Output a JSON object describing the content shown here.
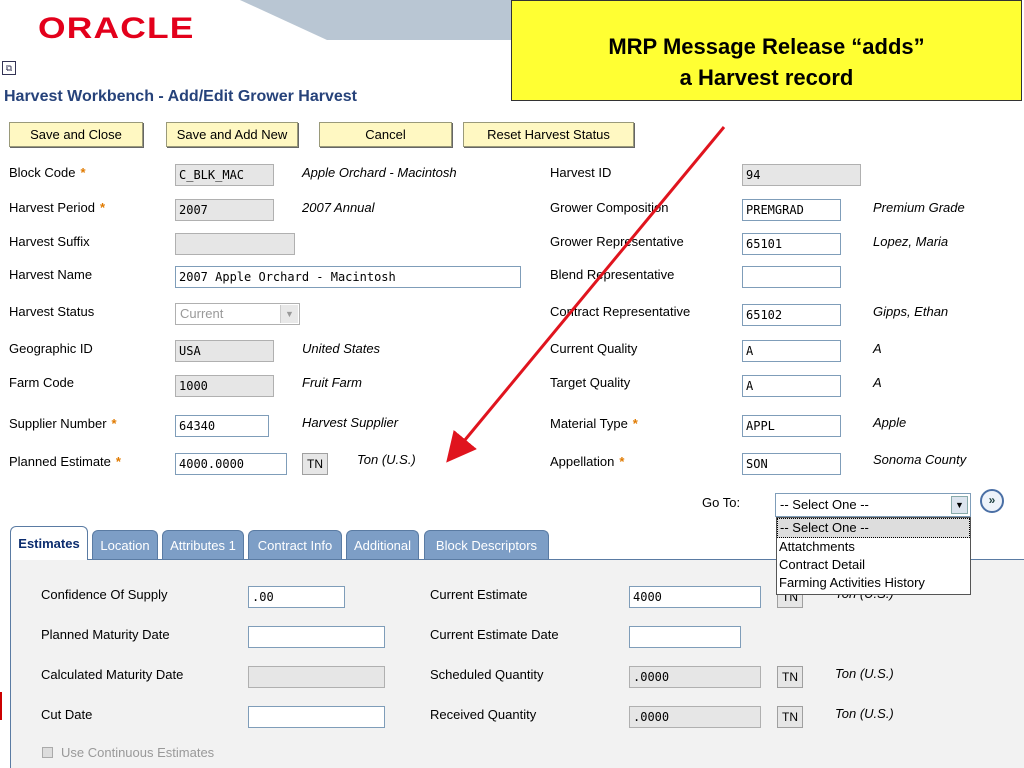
{
  "brand": {
    "logo_text": "ORACLE",
    "logo_color": "#e3001b"
  },
  "callout": {
    "line1": "MRP Message Release “adds”",
    "line2": "a Harvest record"
  },
  "page_title": "Harvest Workbench - Add/Edit Grower Harvest",
  "toolbar": {
    "save_close": "Save and Close",
    "save_add_new": "Save and Add New",
    "cancel": "Cancel",
    "reset_status": "Reset Harvest Status"
  },
  "left_fields": {
    "block_code": {
      "label": "Block Code",
      "value": "C_BLK_MAC",
      "desc": "Apple Orchard - Macintosh"
    },
    "harvest_period": {
      "label": "Harvest Period",
      "value": "2007",
      "desc": "2007 Annual"
    },
    "harvest_suffix": {
      "label": "Harvest Suffix",
      "value": ""
    },
    "harvest_name": {
      "label": "Harvest Name",
      "value": "2007 Apple Orchard - Macintosh"
    },
    "harvest_status": {
      "label": "Harvest Status",
      "value": "Current"
    },
    "geographic_id": {
      "label": "Geographic ID",
      "value": "USA",
      "desc": "United States"
    },
    "farm_code": {
      "label": "Farm Code",
      "value": "1000",
      "desc": "Fruit Farm"
    },
    "supplier_number": {
      "label": "Supplier Number",
      "value": "64340",
      "desc": "Harvest Supplier"
    },
    "planned_estimate": {
      "label": "Planned Estimate",
      "value": "4000.0000",
      "uom": "TN",
      "desc": "Ton (U.S.)"
    }
  },
  "right_fields": {
    "harvest_id": {
      "label": "Harvest ID",
      "value": "94"
    },
    "grower_composition": {
      "label": "Grower Composition",
      "value": "PREMGRAD",
      "desc": "Premium Grade"
    },
    "grower_rep": {
      "label": "Grower Representative",
      "value": "65101",
      "desc": "Lopez, Maria"
    },
    "blend_rep": {
      "label": "Blend Representative",
      "value": ""
    },
    "contract_rep": {
      "label": "Contract Representative",
      "value": "65102",
      "desc": "Gipps, Ethan"
    },
    "current_quality": {
      "label": "Current Quality",
      "value": "A",
      "desc": "A"
    },
    "target_quality": {
      "label": "Target Quality",
      "value": "A",
      "desc": "A"
    },
    "material_type": {
      "label": "Material Type",
      "value": "APPL",
      "desc": "Apple"
    },
    "appellation": {
      "label": "Appellation",
      "value": "SON",
      "desc": "Sonoma County"
    }
  },
  "goto": {
    "label": "Go To:",
    "selected": "-- Select One --",
    "options": [
      "-- Select One --",
      "Attatchments",
      "Contract Detail",
      "Farming Activities History"
    ]
  },
  "tabs": [
    "Estimates",
    "Location",
    "Attributes 1",
    "Contract Info",
    "Additional",
    "Block Descriptors"
  ],
  "estimates": {
    "confidence": {
      "label": "Confidence Of Supply",
      "value": ".00"
    },
    "planned_maturity": {
      "label": "Planned Maturity Date",
      "value": ""
    },
    "calculated_maturity": {
      "label": "Calculated Maturity Date",
      "value": ""
    },
    "cut_date": {
      "label": "Cut Date",
      "value": ""
    },
    "current_estimate": {
      "label": "Current Estimate",
      "value": "4000",
      "uom": "TN",
      "desc": "Ton (U.S.)"
    },
    "current_estimate_date": {
      "label": "Current Estimate Date",
      "value": ""
    },
    "scheduled_quantity": {
      "label": "Scheduled Quantity",
      "value": ".0000",
      "uom": "TN",
      "desc": "Ton (U.S.)"
    },
    "received_quantity": {
      "label": "Received Quantity",
      "value": ".0000",
      "uom": "TN",
      "desc": "Ton (U.S.)"
    },
    "use_continuous": {
      "label": "Use Continuous Estimates"
    }
  },
  "required_marker": "*",
  "colors": {
    "accent": "#26427a",
    "button_bg": "#fff8c2",
    "tab_bg": "#7d9ec6",
    "callout_bg": "#ffff33",
    "arrow": "#e0141e"
  }
}
